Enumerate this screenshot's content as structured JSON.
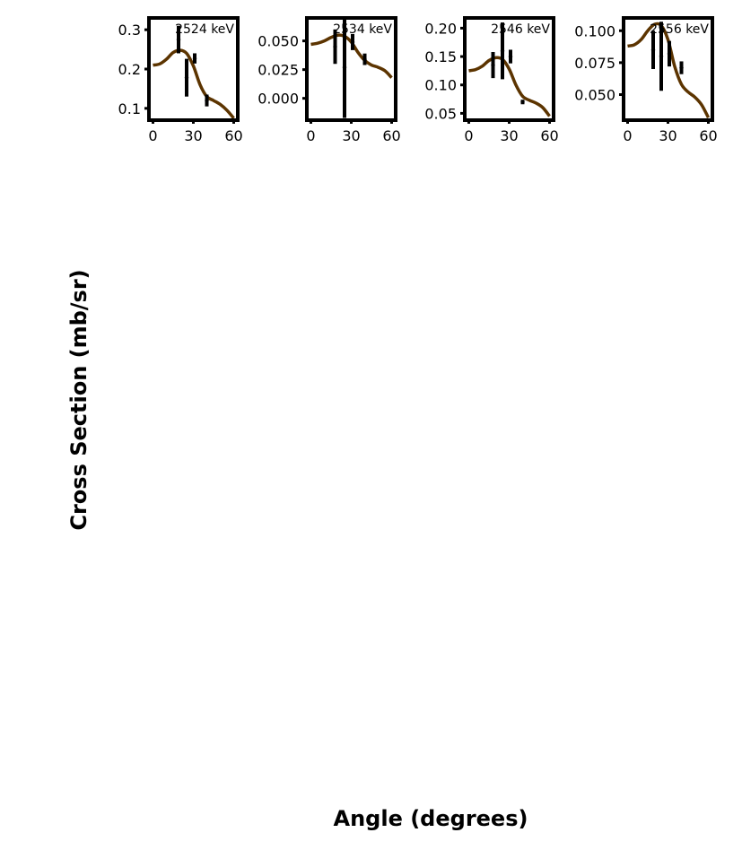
{
  "figure": {
    "xlabel": "Angle (degrees)",
    "ylabel": "Cross Section (mb/sr)"
  },
  "colors": {
    "fit_curve": "#5c3400",
    "data_points": "#000000",
    "axes": "#000000"
  },
  "chart_data": [
    {
      "type": "scatter",
      "label": "2524 keV",
      "xlim": [
        -3,
        63
      ],
      "ylim": [
        0.07,
        0.33
      ],
      "xticks": [
        "0",
        "30",
        "60"
      ],
      "xtick_values": [
        0,
        30,
        60
      ],
      "yticks": [
        "0.1",
        "0.2",
        "0.3"
      ],
      "ytick_values": [
        0.1,
        0.2,
        0.3
      ],
      "points": [
        {
          "x": 19,
          "y": 0.275,
          "err": 0.035
        },
        {
          "x": 25,
          "y": 0.178,
          "err": 0.048
        },
        {
          "x": 31,
          "y": 0.227,
          "err": 0.013
        },
        {
          "x": 40,
          "y": 0.12,
          "err": 0.015
        }
      ],
      "fit": {
        "x": [
          0,
          5,
          10,
          15,
          20,
          25,
          30,
          35,
          40,
          45,
          50,
          55,
          60
        ],
        "y": [
          0.21,
          0.213,
          0.225,
          0.242,
          0.248,
          0.24,
          0.208,
          0.16,
          0.13,
          0.12,
          0.11,
          0.095,
          0.075
        ]
      }
    },
    {
      "type": "scatter",
      "label": "2534 keV",
      "xlim": [
        -3,
        63
      ],
      "ylim": [
        -0.019,
        0.07
      ],
      "xticks": [
        "0",
        "30",
        "60"
      ],
      "xtick_values": [
        0,
        30,
        60
      ],
      "yticks": [
        "0.000",
        "0.025",
        "0.050"
      ],
      "ytick_values": [
        0.0,
        0.025,
        0.05
      ],
      "points": [
        {
          "x": 18,
          "y": 0.045,
          "err": 0.015
        },
        {
          "x": 25,
          "y": 0.027,
          "err": 0.044
        },
        {
          "x": 31,
          "y": 0.049,
          "err": 0.007
        },
        {
          "x": 40,
          "y": 0.034,
          "err": 0.005
        }
      ],
      "fit": {
        "x": [
          0,
          5,
          10,
          15,
          20,
          25,
          30,
          35,
          40,
          45,
          50,
          55,
          60
        ],
        "y": [
          0.047,
          0.048,
          0.05,
          0.053,
          0.055,
          0.054,
          0.049,
          0.04,
          0.033,
          0.029,
          0.027,
          0.024,
          0.018
        ]
      }
    },
    {
      "type": "scatter",
      "label": "2546 keV",
      "xlim": [
        -3,
        63
      ],
      "ylim": [
        0.038,
        0.218
      ],
      "xticks": [
        "0",
        "30",
        "60"
      ],
      "xtick_values": [
        0,
        30,
        60
      ],
      "yticks": [
        "0.05",
        "0.10",
        "0.15",
        "0.20"
      ],
      "ytick_values": [
        0.05,
        0.1,
        0.15,
        0.2
      ],
      "points": [
        {
          "x": 18,
          "y": 0.135,
          "err": 0.023
        },
        {
          "x": 25,
          "y": 0.16,
          "err": 0.05
        },
        {
          "x": 31,
          "y": 0.15,
          "err": 0.012
        },
        {
          "x": 40,
          "y": 0.07,
          "err": 0.004
        }
      ],
      "fit": {
        "x": [
          0,
          5,
          10,
          15,
          20,
          25,
          30,
          35,
          40,
          45,
          50,
          55,
          60
        ],
        "y": [
          0.125,
          0.127,
          0.133,
          0.143,
          0.148,
          0.145,
          0.128,
          0.1,
          0.08,
          0.073,
          0.068,
          0.06,
          0.045
        ]
      }
    },
    {
      "type": "scatter",
      "label": "2556 keV",
      "xlim": [
        -3,
        63
      ],
      "ylim": [
        0.03,
        0.11
      ],
      "xticks": [
        "0",
        "30",
        "60"
      ],
      "xtick_values": [
        0,
        30,
        60
      ],
      "yticks": [
        "0.050",
        "0.075",
        "0.100"
      ],
      "ytick_values": [
        0.05,
        0.075,
        0.1
      ],
      "points": [
        {
          "x": 19,
          "y": 0.085,
          "err": 0.015
        },
        {
          "x": 25,
          "y": 0.08,
          "err": 0.027
        },
        {
          "x": 31,
          "y": 0.082,
          "err": 0.01
        },
        {
          "x": 40,
          "y": 0.071,
          "err": 0.005
        }
      ],
      "fit": {
        "x": [
          0,
          5,
          10,
          15,
          20,
          25,
          30,
          35,
          40,
          45,
          50,
          55,
          60
        ],
        "y": [
          0.088,
          0.089,
          0.093,
          0.1,
          0.105,
          0.104,
          0.093,
          0.072,
          0.058,
          0.052,
          0.048,
          0.042,
          0.032
        ]
      }
    }
  ]
}
